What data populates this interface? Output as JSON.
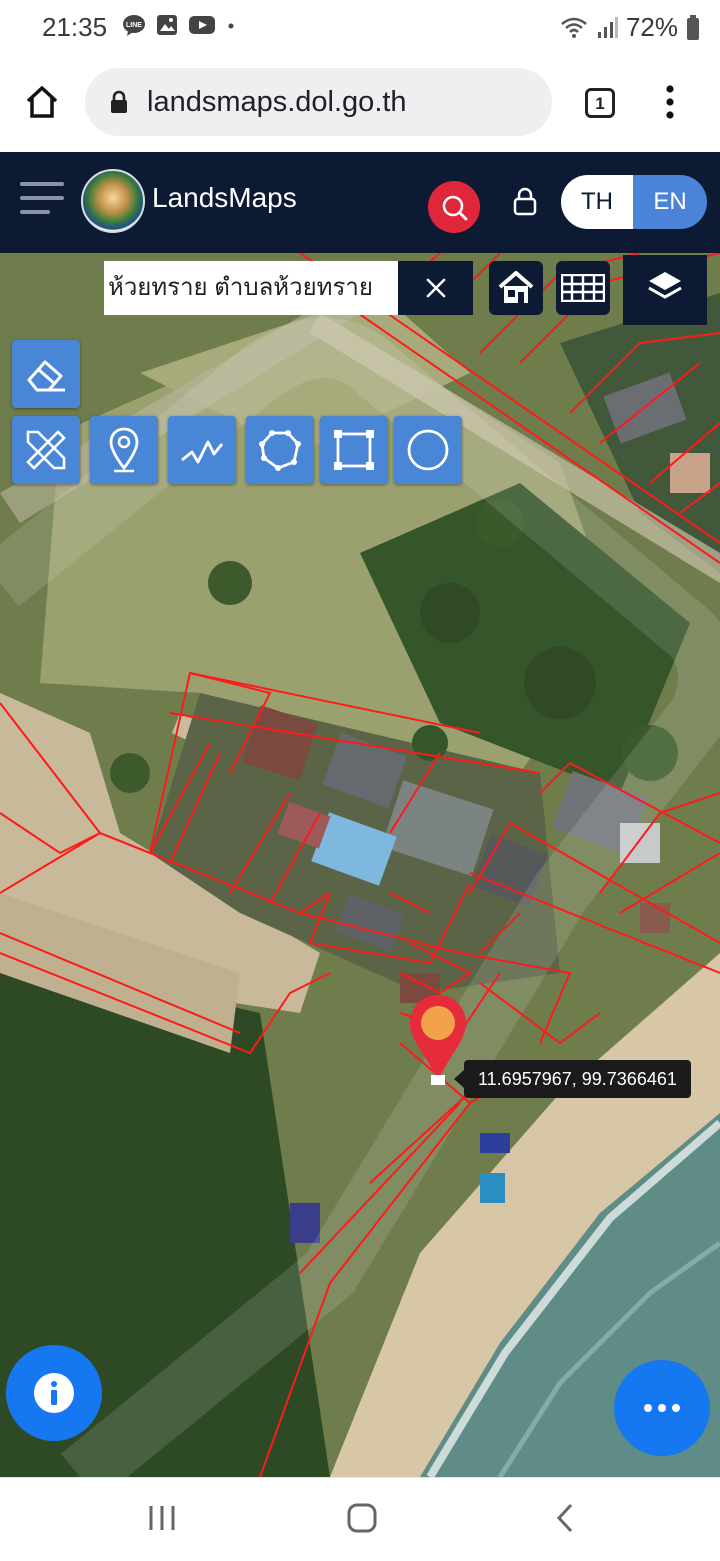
{
  "status_bar": {
    "time": "21:35",
    "notification_icons": [
      "line-icon",
      "gallery-icon",
      "youtube-icon",
      "dot-icon"
    ],
    "battery": "72%"
  },
  "browser": {
    "url": "landsmaps.dol.go.th",
    "tab_count": "1"
  },
  "app": {
    "brand": "LandsMaps",
    "lang_th": "TH",
    "lang_en": "EN",
    "active_lang": "EN"
  },
  "search": {
    "value": "ห้วยทราย ตำบลห้วยทราย"
  },
  "tools": [
    {
      "name": "eraser-icon"
    },
    {
      "name": "ruler-pencil-icon"
    },
    {
      "name": "map-pin-icon"
    },
    {
      "name": "polyline-icon"
    },
    {
      "name": "polygon-icon"
    },
    {
      "name": "rectangle-icon"
    },
    {
      "name": "circle-icon"
    }
  ],
  "marker": {
    "coordinates": "11.6957967, 99.7366461"
  },
  "colors": {
    "navbar": "#0c1a33",
    "accent_blue": "#4a86d6",
    "search_red": "#e0273a",
    "parcel_lines": "#ff1a1a",
    "fab_blue": "#1678f0"
  }
}
